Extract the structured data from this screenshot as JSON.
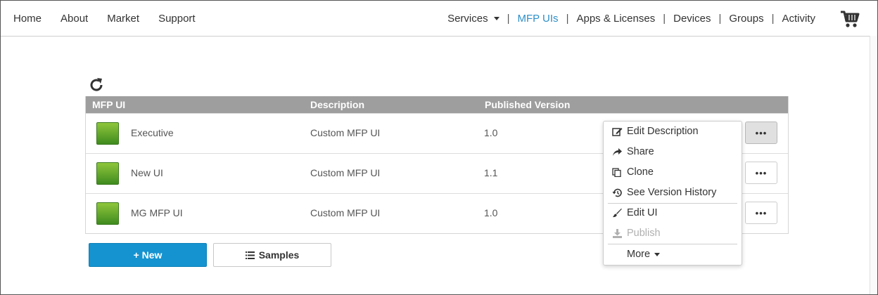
{
  "nav": {
    "left": [
      "Home",
      "About",
      "Market",
      "Support"
    ],
    "services": "Services",
    "mfp_uis": "MFP UIs",
    "apps": "Apps & Licenses",
    "devices": "Devices",
    "groups": "Groups",
    "activity": "Activity",
    "separator": "|",
    "active_color": "#2f8fc8"
  },
  "table": {
    "headers": [
      "MFP UI",
      "Description",
      "Published Version"
    ],
    "rows": [
      {
        "name": "Executive",
        "description": "Custom MFP UI",
        "version": "1.0"
      },
      {
        "name": "New UI",
        "description": "Custom MFP UI",
        "version": "1.1"
      },
      {
        "name": "MG MFP UI",
        "description": "Custom MFP UI",
        "version": "1.0"
      }
    ],
    "more_label": "•••"
  },
  "menu": {
    "items": [
      "Edit Description",
      "Share",
      "Clone",
      "See Version History",
      "Edit UI",
      "Publish",
      "More"
    ]
  },
  "buttons": {
    "new": "+ New",
    "samples": "Samples",
    "primary_color": "#1593d0"
  }
}
